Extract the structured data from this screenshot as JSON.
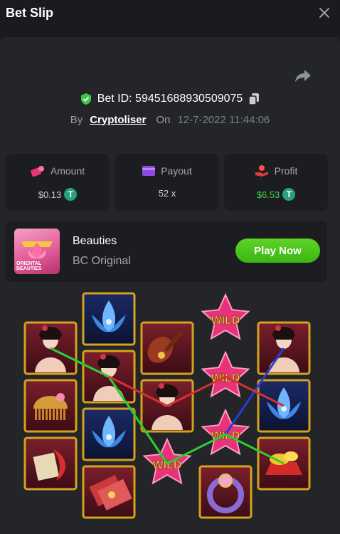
{
  "header": {
    "title": "Bet Slip"
  },
  "bet": {
    "id_label": "Bet ID: 59451688930509075",
    "by_label": "By",
    "user": "Cryptoliser",
    "on_label": "On",
    "datetime": "12-7-2022 11:44:06"
  },
  "stats": {
    "amount": {
      "label": "Amount",
      "value": "$0.13"
    },
    "payout": {
      "label": "Payout",
      "value": "52 x"
    },
    "profit": {
      "label": "Profit",
      "value": "$6.53"
    }
  },
  "game": {
    "name": "Beauties",
    "provider": "BC Original",
    "thumb_text_1": "ORIENTAL",
    "thumb_text_2": "BEAUTIES",
    "play_label": "Play Now"
  },
  "reels": {
    "wild_label": "WILD",
    "columns": [
      [
        "beauty",
        "comb",
        "scroll-box"
      ],
      [
        "lotus",
        "beauty",
        "lotus",
        "envelope"
      ],
      [
        "pipa",
        "beauty",
        "wild"
      ],
      [
        "wild",
        "wild",
        "wild",
        "ring"
      ],
      [
        "beauty",
        "lotus",
        "gold"
      ]
    ],
    "paylines": [
      {
        "color": "#2b3bd6"
      },
      {
        "color": "#2bd02b"
      },
      {
        "color": "#d63131"
      }
    ]
  },
  "colors": {
    "accent_green": "#43d24a",
    "tether": "#26a17b",
    "wild_pink": "#e8337a",
    "tile_border": "#d4a21c"
  }
}
